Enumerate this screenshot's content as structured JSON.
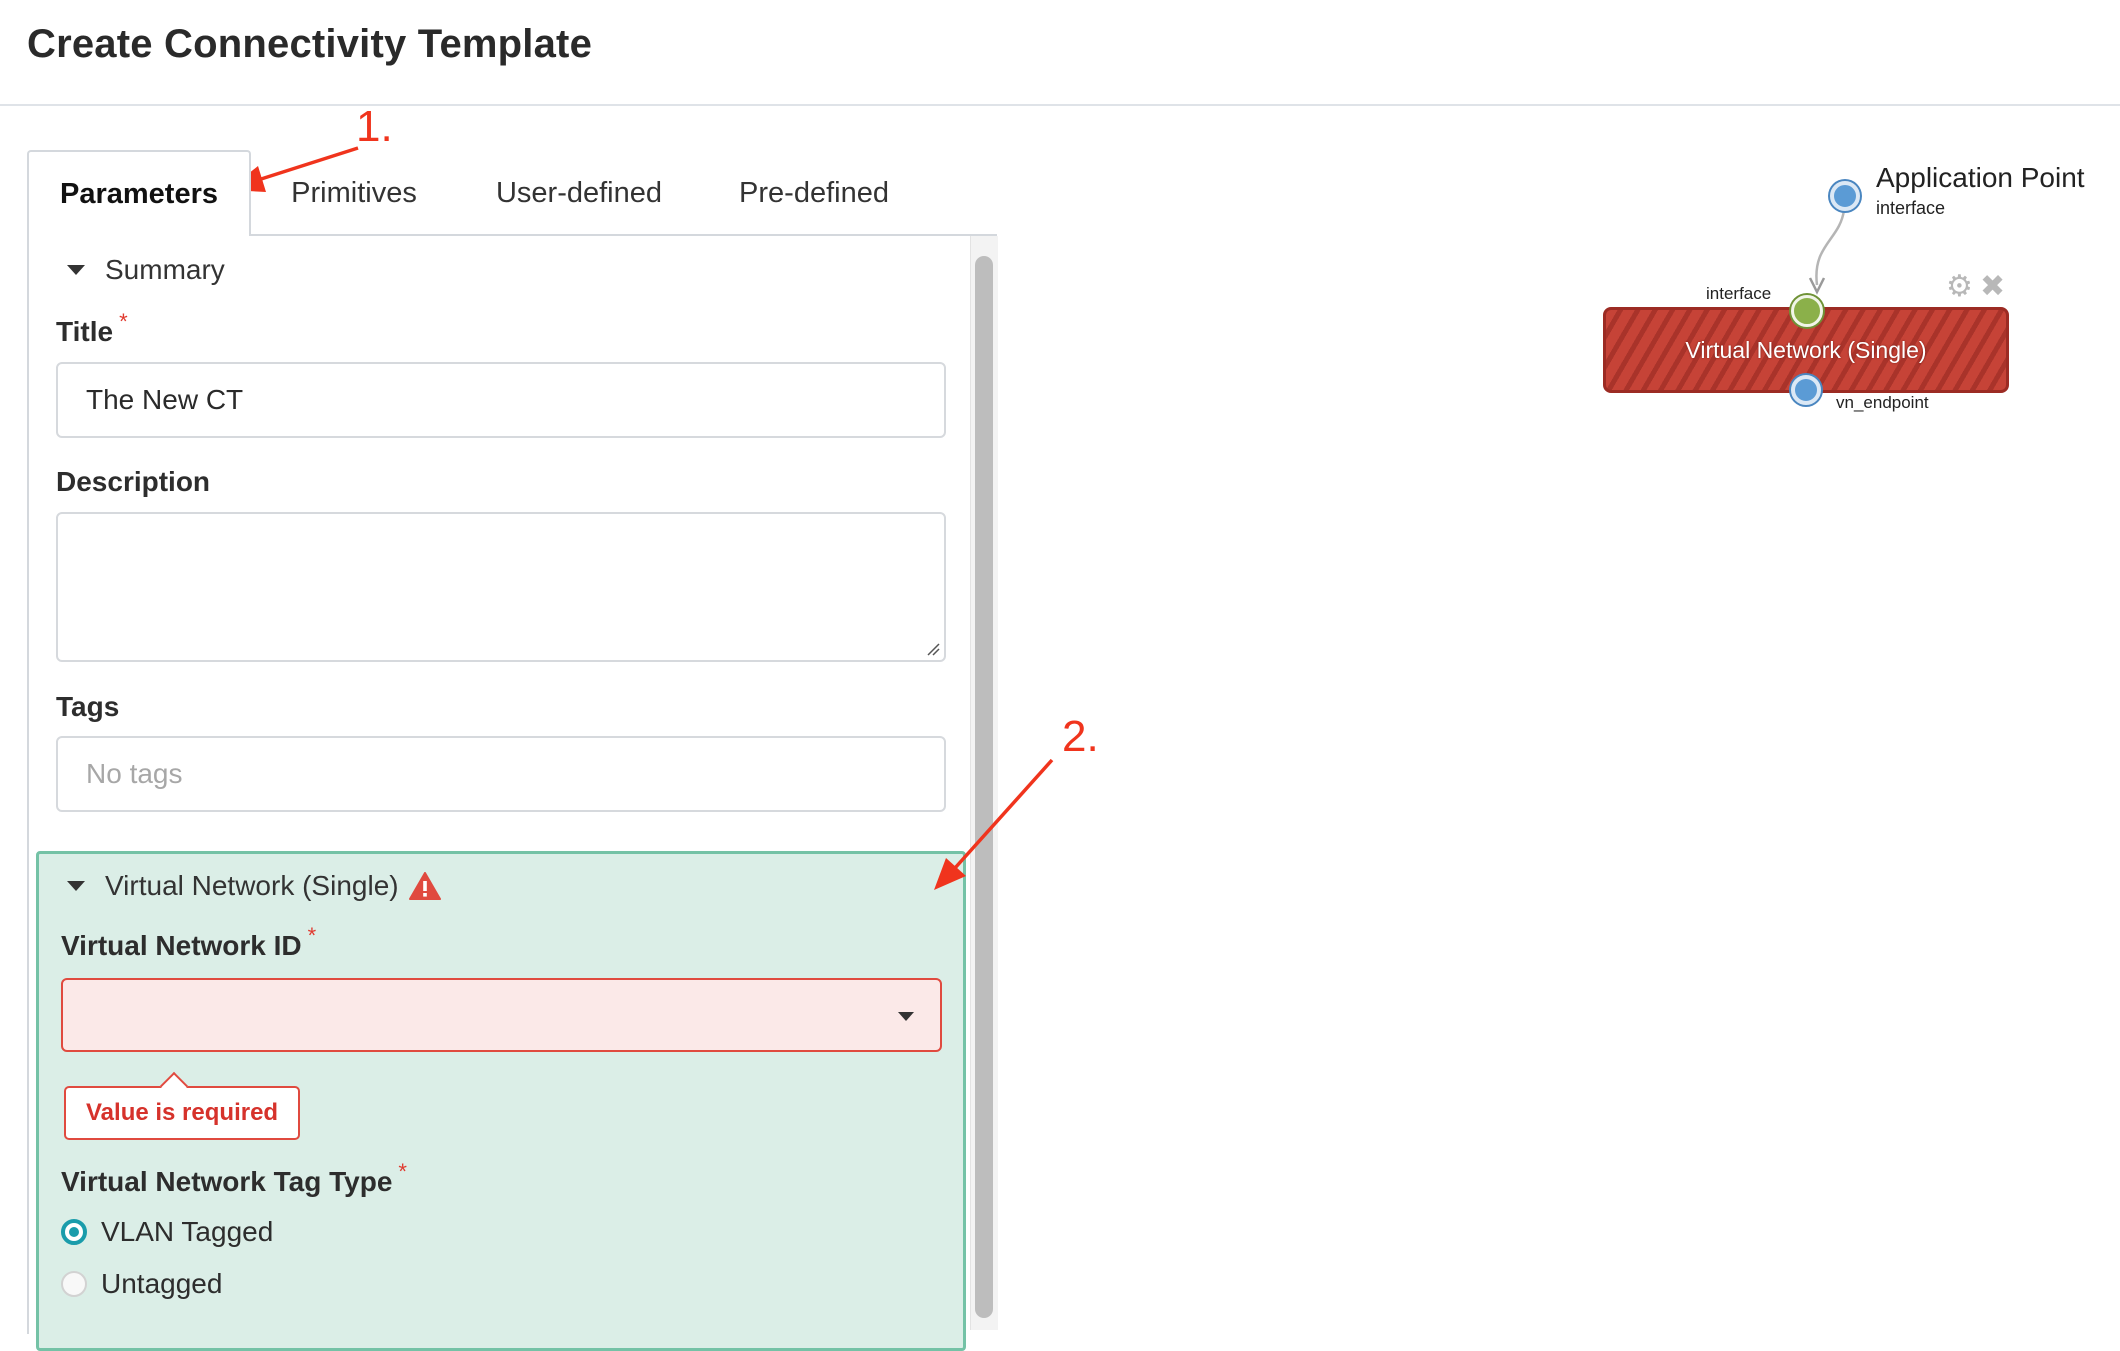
{
  "page": {
    "title": "Create Connectivity Template"
  },
  "tabs": [
    {
      "label": "Parameters",
      "active": true
    },
    {
      "label": "Primitives",
      "active": false
    },
    {
      "label": "User-defined",
      "active": false
    },
    {
      "label": "Pre-defined",
      "active": false
    }
  ],
  "summary": {
    "header": "Summary",
    "title_label": "Title",
    "title_value": "The New CT",
    "description_label": "Description",
    "description_value": "",
    "tags_label": "Tags",
    "tags_placeholder": "No tags"
  },
  "virtual_network": {
    "header": "Virtual Network (Single)",
    "vn_id_label": "Virtual Network ID",
    "vn_id_value": "",
    "error_text": "Value is required",
    "tag_type_label": "Virtual Network Tag Type",
    "options": [
      {
        "label": "VLAN Tagged",
        "selected": true
      },
      {
        "label": "Untagged",
        "selected": false
      }
    ]
  },
  "annotations": {
    "step1": "1.",
    "step2": "2."
  },
  "canvas": {
    "app_point_title": "Application Point",
    "app_point_sub": "interface",
    "node_label": "Virtual Network (Single)",
    "input_port_label": "interface",
    "output_port_label": "vn_endpoint"
  },
  "colors": {
    "accent": "#1a9cab",
    "error": "#e04a3f",
    "section_bg": "#dbeee7",
    "section_border": "#74c2a6",
    "node_red": "#c64337",
    "port_blue": "#5b9bd5",
    "port_green": "#8bb04a",
    "annotation_red": "#f0341d"
  },
  "icons": [
    "caret-down-icon",
    "warning-icon",
    "gear-icon",
    "close-icon",
    "dropdown-caret-icon"
  ]
}
